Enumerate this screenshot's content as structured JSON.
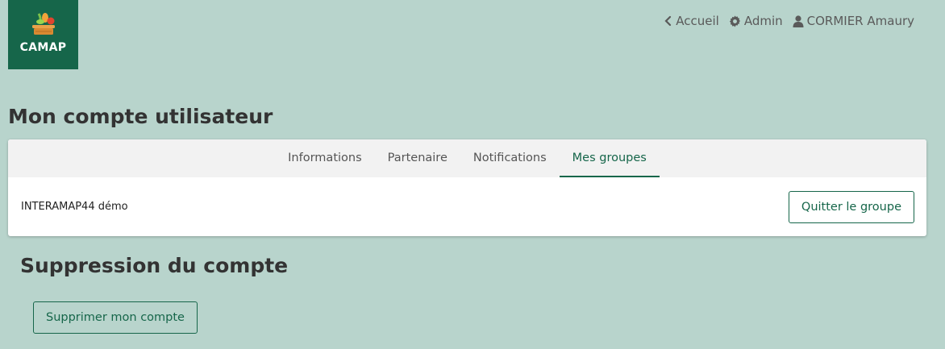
{
  "brand": {
    "name": "CAMAP",
    "color": "#16664a"
  },
  "nav": {
    "items": [
      {
        "label": "Accueil",
        "icon": "chevron-left-icon"
      },
      {
        "label": "Admin",
        "icon": "gear-icon"
      },
      {
        "label": "CORMIER Amaury",
        "icon": "user-icon"
      }
    ]
  },
  "page": {
    "title": "Mon compte utilisateur"
  },
  "tabs": [
    {
      "label": "Informations",
      "active": false
    },
    {
      "label": "Partenaire",
      "active": false
    },
    {
      "label": "Notifications",
      "active": false
    },
    {
      "label": "Mes groupes",
      "active": true
    }
  ],
  "groups": [
    {
      "name": "INTERAMAP44 démo",
      "action_label": "Quitter le groupe"
    }
  ],
  "deletion": {
    "title": "Suppression du compte",
    "button_label": "Supprimer mon compte"
  },
  "colors": {
    "background": "#b8d4cc",
    "accent": "#16664a"
  }
}
